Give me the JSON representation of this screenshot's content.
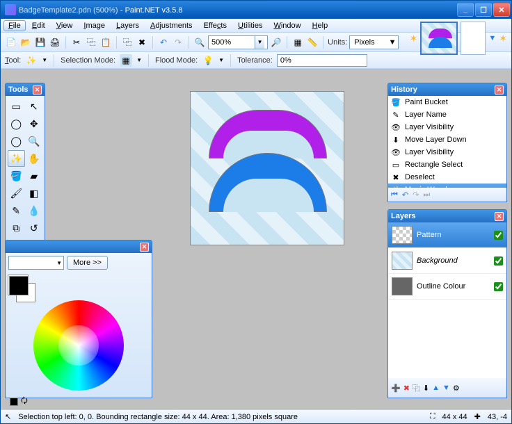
{
  "title": {
    "doc": "BadgeTemplate2.pdn (500%)",
    "app": "Paint.NET v3.5.8"
  },
  "menu": [
    "File",
    "Edit",
    "View",
    "Image",
    "Layers",
    "Adjustments",
    "Effects",
    "Utilities",
    "Window",
    "Help"
  ],
  "toolbar": {
    "zoom": "500%",
    "unitsLabel": "Units:",
    "units": "Pixels"
  },
  "tooloptions": {
    "toolLabel": "Tool:",
    "selModeLabel": "Selection Mode:",
    "floodLabel": "Flood Mode:",
    "tolLabel": "Tolerance:",
    "tol": "0%"
  },
  "toolsPanel": {
    "title": "Tools"
  },
  "colorsPanel": {
    "moreLabel": "More >>"
  },
  "historyPanel": {
    "title": "History",
    "items": [
      "Paint Bucket",
      "Layer Name",
      "Layer Visibility",
      "Move Layer Down",
      "Layer Visibility",
      "Rectangle Select",
      "Deselect",
      "Magic Wand"
    ]
  },
  "layersPanel": {
    "title": "Layers",
    "items": [
      {
        "name": "Pattern",
        "checked": true,
        "sel": true,
        "thumb": "pat"
      },
      {
        "name": "Background",
        "checked": true,
        "sel": false,
        "thumb": "bg",
        "italic": true
      },
      {
        "name": "Outline Colour",
        "checked": true,
        "sel": false,
        "thumb": "oc"
      }
    ]
  },
  "status": {
    "sel": "Selection top left: 0, 0. Bounding rectangle size: 44 x 44. Area: 1,380 pixels square",
    "size": "44 x 44",
    "pos": "43, -4"
  }
}
